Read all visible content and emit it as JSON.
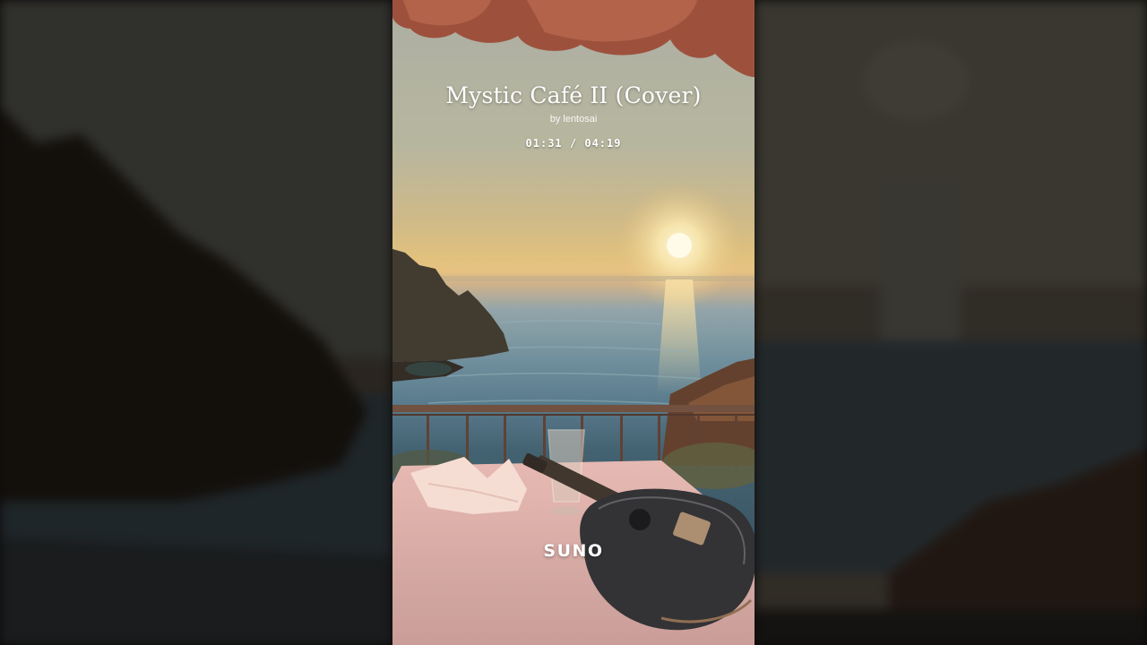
{
  "player": {
    "title": "Mystic Café II (Cover)",
    "byline": "by lentosai",
    "current_time": "01:31",
    "separator": "/",
    "total_time": "04:19"
  },
  "brand": {
    "logo_text": "SUNO"
  },
  "colors": {
    "awning": "#9a4a36",
    "sun": "#fff4cf",
    "sea": "#55788a",
    "table": "#e6b7b0",
    "guitar": "#2b2b2e"
  }
}
